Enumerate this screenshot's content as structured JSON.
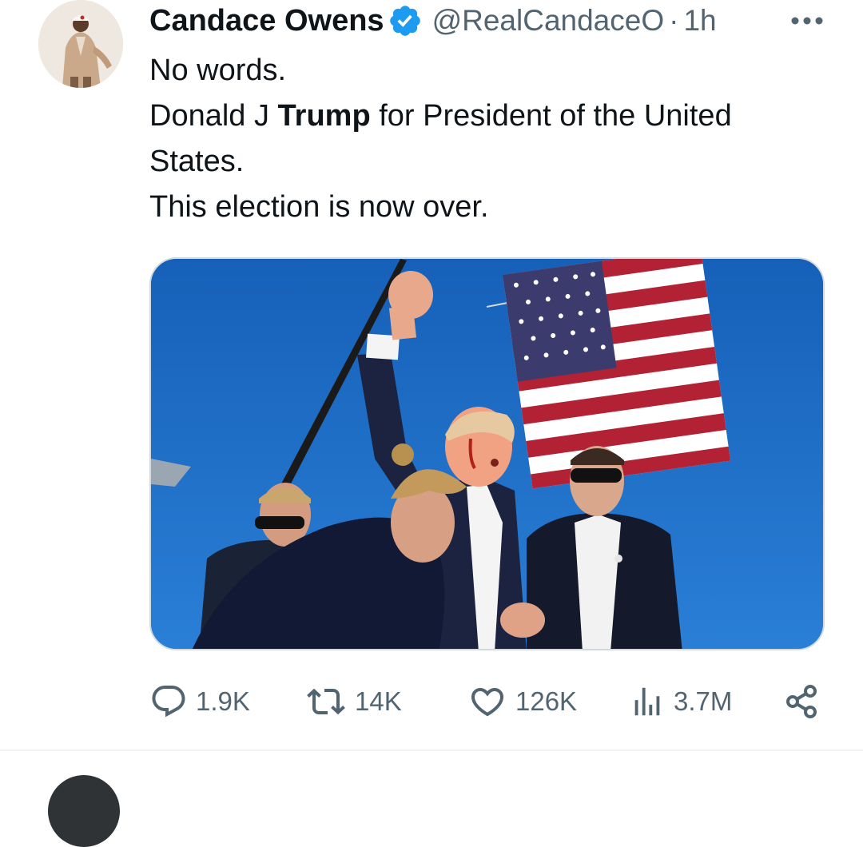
{
  "tweet": {
    "author": {
      "display_name": "Candace Owens",
      "handle": "@RealCandaceO",
      "verified": true,
      "avatar_icon": "profile-photo"
    },
    "separator": "·",
    "time": "1h",
    "more_icon": "more-horizontal-icon",
    "text_lines": {
      "line1": "No words.",
      "line2_pre": "Donald J ",
      "line2_bold": "Trump",
      "line2_post": " for President of the United States.",
      "line3": "This election is now over."
    },
    "media": {
      "type": "photo"
    },
    "actions": {
      "reply": {
        "icon": "reply-icon",
        "count": "1.9K"
      },
      "repost": {
        "icon": "repost-icon",
        "count": "14K"
      },
      "like": {
        "icon": "heart-icon",
        "count": "126K"
      },
      "views": {
        "icon": "views-icon",
        "count": "3.7M"
      },
      "share": {
        "icon": "share-icon"
      }
    }
  },
  "colors": {
    "text_primary": "#0f1419",
    "text_secondary": "#536471",
    "verified_blue": "#1d9bf0",
    "border": "#cfd9de",
    "sky": "#1f6bc2"
  }
}
